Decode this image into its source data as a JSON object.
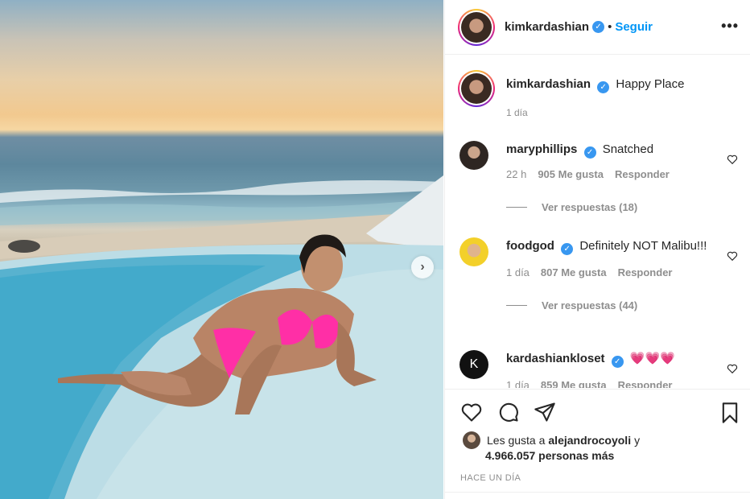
{
  "post": {
    "author": "kimkardashian",
    "follow_label": "Seguir",
    "dot": "•",
    "more_label": "•••",
    "caption": "Happy Place",
    "caption_time": "1 día"
  },
  "comments": [
    {
      "user": "maryphillips",
      "text": "Snatched",
      "time": "22 h",
      "likes": "905 Me gusta",
      "reply": "Responder",
      "replies": "Ver respuestas (18)"
    },
    {
      "user": "foodgod",
      "text": "Definitely NOT Malibu!!!",
      "time": "1 día",
      "likes": "807 Me gusta",
      "reply": "Responder",
      "replies": "Ver respuestas (44)"
    },
    {
      "user": "kardashiankloset",
      "text": "💗💗💗",
      "time": "1 día",
      "likes": "859 Me gusta",
      "reply": "Responder"
    }
  ],
  "likes": {
    "prefix": "Les gusta a",
    "user": "alejandrocoyoli",
    "suffix": "y",
    "count_line": "4.966.057 personas más"
  },
  "timestamp": "HACE UN DÍA",
  "icons": {
    "verified": "✓",
    "next": "›",
    "kloset_initial": "K"
  },
  "colors": {
    "link": "#0095f6",
    "verified": "#3897f0",
    "muted": "#8e8e8e"
  }
}
